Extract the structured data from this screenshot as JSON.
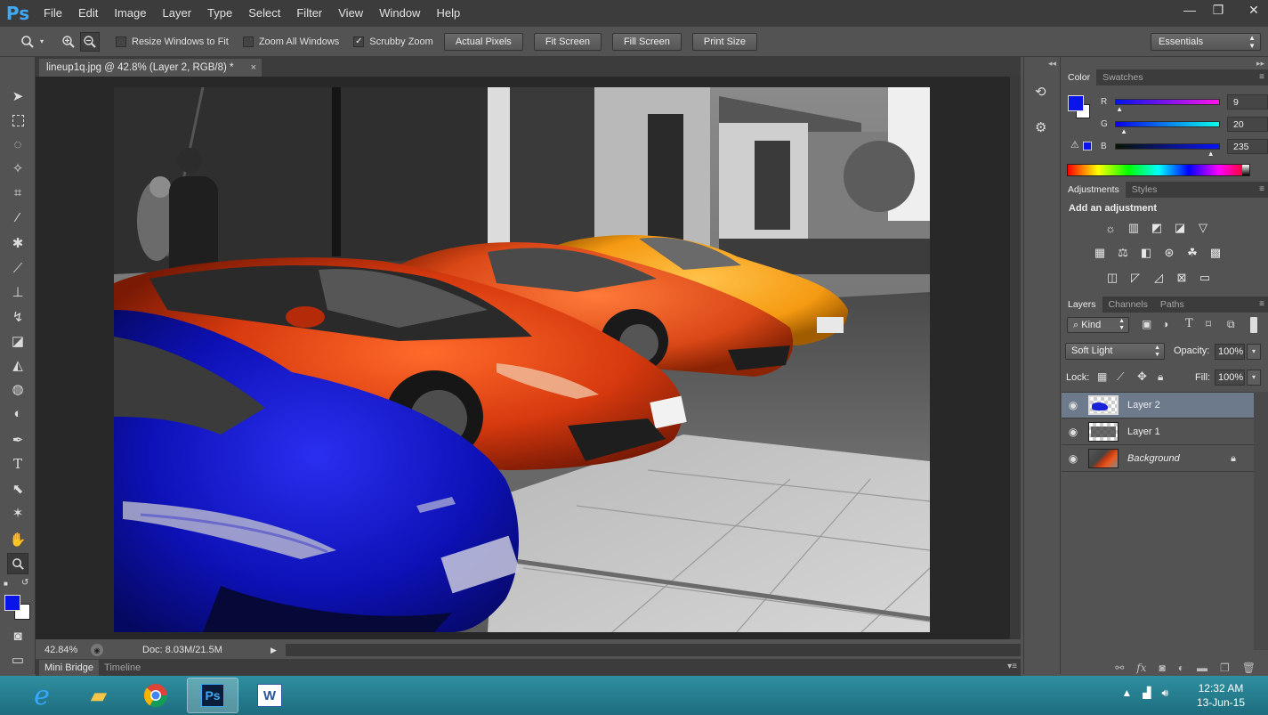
{
  "app": {
    "logo": "Ps"
  },
  "menu": [
    "File",
    "Edit",
    "Image",
    "Layer",
    "Type",
    "Select",
    "Filter",
    "View",
    "Window",
    "Help"
  ],
  "window_controls": {
    "minimize": "—",
    "restore": "❐",
    "close": "✕"
  },
  "options": {
    "resize_windows": "Resize Windows to Fit",
    "zoom_all": "Zoom All Windows",
    "scrubby_zoom": "Scrubby Zoom",
    "scrubby_checked": "✓",
    "actual_pixels": "Actual Pixels",
    "fit_screen": "Fit Screen",
    "fill_screen": "Fill Screen",
    "print_size": "Print Size",
    "workspace": "Essentials"
  },
  "document": {
    "tab_title": "lineup1q.jpg @ 42.8% (Layer 2, RGB/8) *",
    "close": "×"
  },
  "status": {
    "zoom": "42.84%",
    "doc": "Doc: 8.03M/21.5M"
  },
  "bottom_tabs": [
    "Mini Bridge",
    "Timeline"
  ],
  "color_panel": {
    "tabs": [
      "Color",
      "Swatches"
    ],
    "r_label": "R",
    "g_label": "G",
    "b_label": "B",
    "r": "9",
    "g": "20",
    "b": "235",
    "foreground": "#0914eb",
    "r_fraction": 0.035,
    "g_fraction": 0.078,
    "b_fraction": 0.92
  },
  "adjustments_panel": {
    "tabs": [
      "Adjustments",
      "Styles"
    ],
    "heading": "Add an adjustment"
  },
  "layers_panel": {
    "tabs": [
      "Layers",
      "Channels",
      "Paths"
    ],
    "filter": "Kind",
    "blend_mode": "Soft Light",
    "opacity_label": "Opacity:",
    "opacity": "100%",
    "lock_label": "Lock:",
    "fill_label": "Fill:",
    "fill": "100%",
    "layers": [
      {
        "name": "Layer 2"
      },
      {
        "name": "Layer 1"
      },
      {
        "name": "Background"
      }
    ]
  },
  "taskbar": {
    "time": "12:32 AM",
    "date": "13-Jun-15",
    "ps_label": "Ps",
    "word_label": "W"
  }
}
